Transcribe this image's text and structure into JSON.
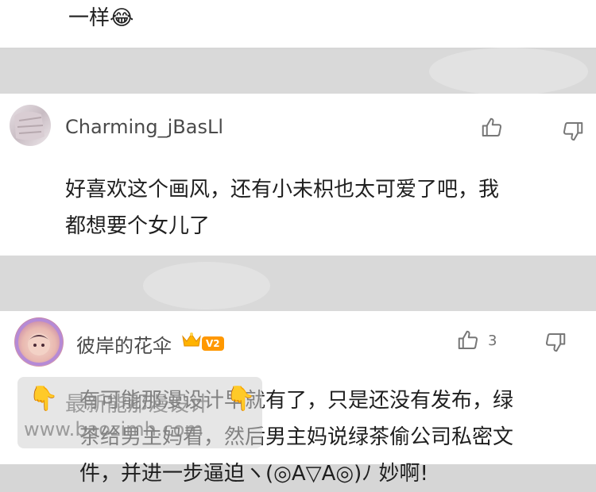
{
  "comments": [
    {
      "text_lines": [
        "一样😂"
      ]
    },
    {
      "username": "Charming_jBasLl",
      "text_lines": [
        "好喜欢这个画风，还有小未枳也太可爱了吧，我",
        "都想要个女儿了"
      ]
    },
    {
      "username": "彼岸的花伞",
      "badge": "V2",
      "like_count": "3",
      "text_lines": [
        "有可能那漫设计早就有了，只是还没有发布，绿",
        "茶给男主妈看，然后男主妈说绿茶偷公司私密文",
        "件，并进一步逼迫ヽ(◎A▽A◎)ﾉ 妙啊!"
      ]
    }
  ],
  "watermark": {
    "line1": "最新能那漫设计",
    "line2": "www.baozimh.com",
    "hand_icon": "pointing-down-emoji"
  },
  "icons": {
    "like": "thumbs-up-icon",
    "dislike": "thumbs-down-icon"
  }
}
